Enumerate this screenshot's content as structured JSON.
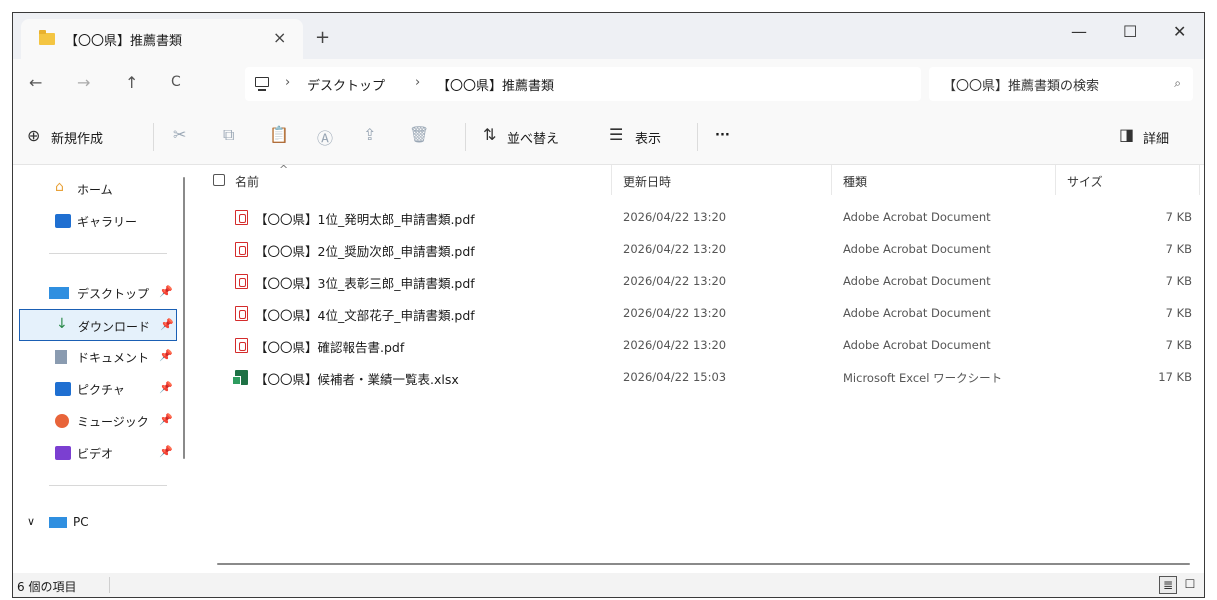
{
  "window": {
    "tab_title": "【〇〇県】推薦書類",
    "tab_close": "×",
    "new_tab": "+",
    "minimize": "—",
    "maximize": "☐",
    "close": "✕"
  },
  "address": {
    "back": "←",
    "forward": "→",
    "up": "↑",
    "refresh": "C",
    "separator": "›",
    "crumbs": [
      "デスクトップ",
      "【〇〇県】推薦書類"
    ],
    "search_placeholder": "【〇〇県】推薦書類の検索",
    "search_icon": "⌕"
  },
  "commands": {
    "new_icon": "⊕",
    "new_label": "新規作成",
    "cut_icon": "✂",
    "copy_icon": "⧉",
    "paste_icon": "📋",
    "rename_icon": "Ⓐ",
    "share_icon": "⇪",
    "delete_icon": "🗑",
    "sort_icon": "⇅",
    "sort_label": "並べ替え",
    "view_icon": "☰",
    "view_label": "表示",
    "more_label": "···",
    "details_icon": "◨",
    "details_label": "詳細"
  },
  "nav": {
    "items": [
      {
        "label": "ホーム",
        "icon": "home-icon"
      },
      {
        "label": "ギャラリー",
        "icon": "gallery-icon"
      },
      {
        "label": "デスクトップ",
        "icon": "desktop-icon"
      },
      {
        "label": "ダウンロード",
        "icon": "download-icon"
      },
      {
        "label": "ドキュメント",
        "icon": "document-icon"
      },
      {
        "label": "ピクチャ",
        "icon": "pictures-icon"
      },
      {
        "label": "ミュージック",
        "icon": "music-icon"
      },
      {
        "label": "ビデオ",
        "icon": "video-icon"
      },
      {
        "label": "PC",
        "icon": "pc-icon"
      }
    ],
    "pin": "📌",
    "expand": "∨"
  },
  "columns": {
    "sort_arrow": "^",
    "name": "名前",
    "date": "更新日時",
    "type": "種類",
    "size": "サイズ"
  },
  "files": [
    {
      "name": "【〇〇県】1位_発明太郎_申請書類.pdf",
      "date": "2026/04/22 13:20",
      "type": "Adobe Acrobat Document",
      "size": "7 KB"
    },
    {
      "name": "【〇〇県】2位_奨励次郎_申請書類.pdf",
      "date": "2026/04/22 13:20",
      "type": "Adobe Acrobat Document",
      "size": "7 KB"
    },
    {
      "name": "【〇〇県】3位_表彰三郎_申請書類.pdf",
      "date": "2026/04/22 13:20",
      "type": "Adobe Acrobat Document",
      "size": "7 KB"
    },
    {
      "name": "【〇〇県】4位_文部花子_申請書類.pdf",
      "date": "2026/04/22 13:20",
      "type": "Adobe Acrobat Document",
      "size": "7 KB"
    },
    {
      "name": "【〇〇県】確認報告書.pdf",
      "date": "2026/04/22 13:20",
      "type": "Adobe Acrobat Document",
      "size": "7 KB"
    },
    {
      "name": "【〇〇県】候補者・業績一覧表.xlsx",
      "date": "2026/04/22 15:03",
      "type": "Microsoft Excel ワークシート",
      "size": "17 KB"
    }
  ],
  "status": {
    "count": "6 個の項目",
    "details_view_icon": "≣",
    "tiles_view_icon": "☐"
  }
}
